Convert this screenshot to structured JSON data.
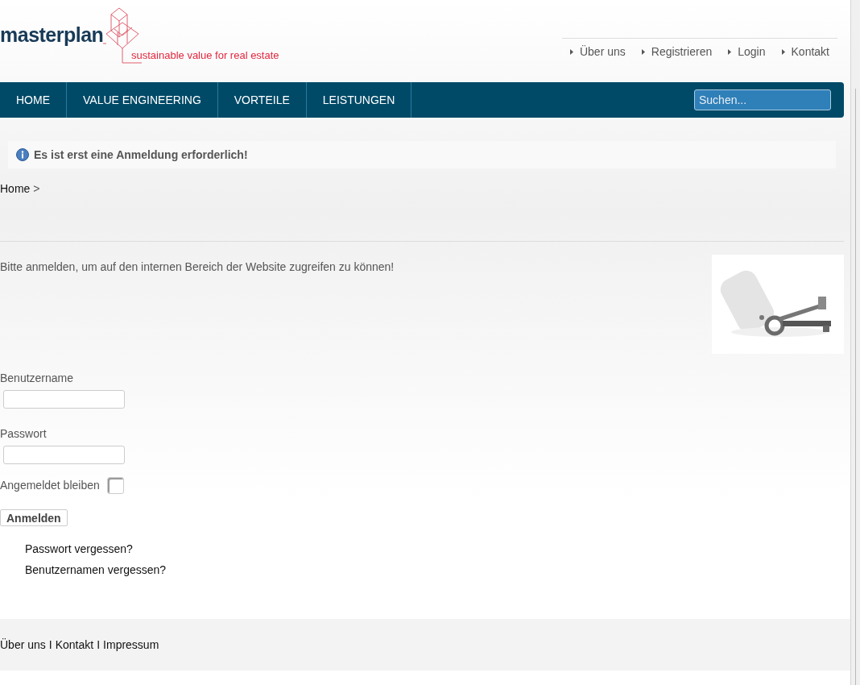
{
  "logo": {
    "wordmark": "masterplan",
    "tagline": "sustainable value for real estate"
  },
  "top_links": [
    "Über uns",
    "Registrieren",
    "Login",
    "Kontakt"
  ],
  "nav": {
    "items": [
      "HOME",
      "VALUE ENGINEERING",
      "VORTEILE",
      "LEISTUNGEN"
    ],
    "search": {
      "placeholder": "Suchen..."
    }
  },
  "notice": "Es ist erst eine Anmeldung erforderlich!",
  "breadcrumb": {
    "items": [
      "Home"
    ],
    "separator": ">"
  },
  "intro": "Bitte anmelden, um auf den internen Bereich der Website zugreifen zu können!",
  "form": {
    "username_label": "Benutzername",
    "password_label": "Passwort",
    "remember": {
      "label": "Angemeldet bleiben",
      "checked": false
    },
    "submit": "Anmelden",
    "links": [
      "Passwort vergessen?",
      "Benutzernamen vergessen?"
    ]
  },
  "footer": {
    "links": [
      "Über uns",
      "Kontakt",
      "Impressum"
    ],
    "separators": [
      "I",
      "I"
    ]
  }
}
